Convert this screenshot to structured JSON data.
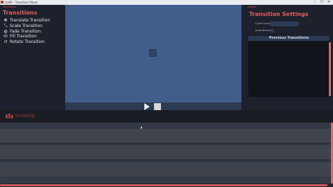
{
  "window": {
    "title": "GoRP - Transition Player",
    "controls": [
      "–",
      "☐",
      "✕"
    ]
  },
  "left_panel": {
    "header": "Transitions",
    "title": "Transitions",
    "items": [
      {
        "label": "Translate Transition",
        "icon": "move-icon",
        "glyph": "✥"
      },
      {
        "label": "Scale Transition",
        "icon": "scale-icon",
        "glyph": "⤡"
      },
      {
        "label": "Fade Transition",
        "icon": "fade-icon",
        "glyph": "◍"
      },
      {
        "label": "Fill Transition",
        "icon": "fill-icon",
        "glyph": "⛁"
      },
      {
        "label": "Rotate Transition",
        "icon": "rotate-icon",
        "glyph": "↺"
      }
    ]
  },
  "right_panel": {
    "header": "Inspect",
    "title": "Transition Settings",
    "cycle_label": "Cycle Count",
    "cycle_value": "",
    "auto_label": "Auto Reverse",
    "list_header": "Previous Transitions"
  },
  "playback": {
    "play_icon": "play-icon",
    "stop_icon": "stop-icon"
  },
  "brand": {
    "name": "Sneaking",
    "color": "#a03c3c"
  },
  "colors": {
    "accent": "#e06060",
    "viewport": "#415d8b",
    "panel": "#1c212b"
  }
}
